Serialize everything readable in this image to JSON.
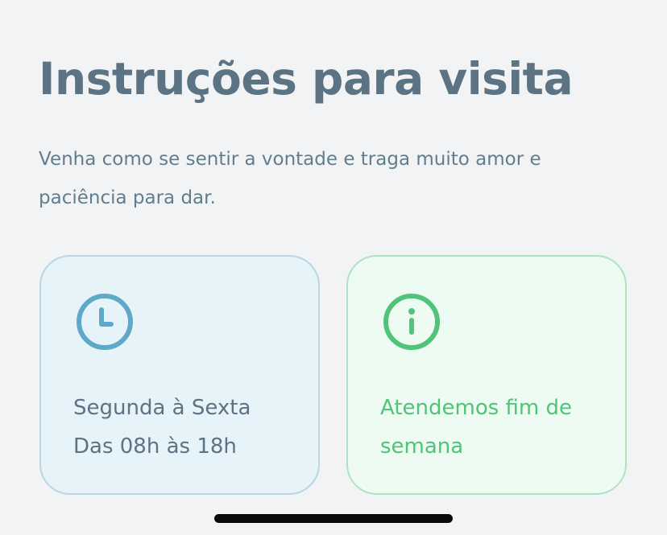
{
  "page": {
    "title": "Instruções para visita",
    "description": "Venha como se sentir a vontade e traga muito amor e paciência para dar."
  },
  "cards": [
    {
      "icon": "clock-icon",
      "lines": [
        "Segunda à Sexta",
        "Das 08h às 18h"
      ],
      "accent": "#5fa9c8"
    },
    {
      "icon": "info-icon",
      "lines": [
        "Atendemos fim de",
        "semana"
      ],
      "accent": "#4fc47a"
    }
  ],
  "colors": {
    "background": "#f2f3f5",
    "title": "#5c7384",
    "schedule_card_bg": "#e6f3f9",
    "schedule_card_border": "#b6d7e3",
    "weekend_card_bg": "#eefbf2",
    "weekend_card_border": "#aee3c2"
  }
}
